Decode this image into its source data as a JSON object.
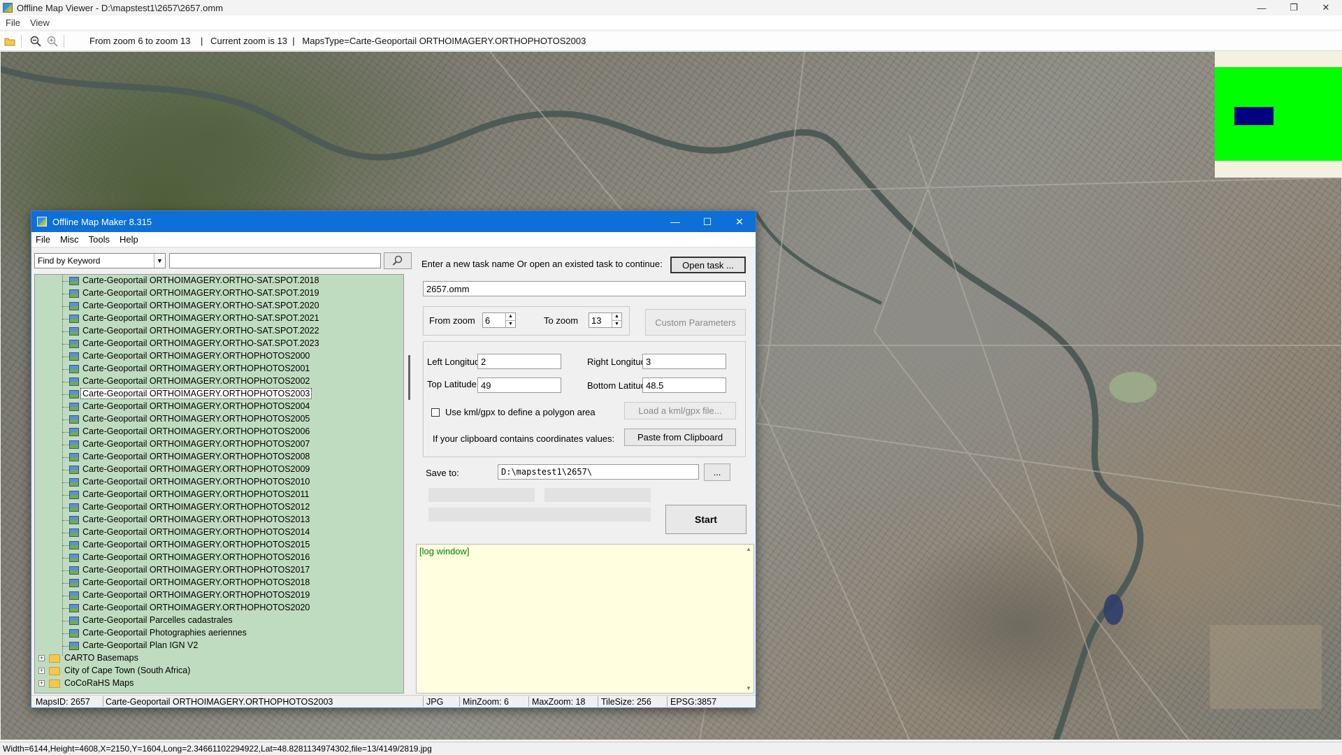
{
  "viewer": {
    "title": "Offline Map Viewer - D:\\mapstest1\\2657\\2657.omm",
    "menu": [
      "File",
      "View"
    ],
    "toolbar_info": "From zoom 6 to zoom 13    |   Current zoom is 13  |   MapsType=Carte-Geoportail ORTHOIMAGERY.ORTHOPHOTOS2003",
    "status": "Width=6144,Height=4608,X=2150,Y=1604,Long=2.34661102294922,Lat=48.8281134974302,file=13/4149/2819.jpg",
    "icons": [
      "open-folder-icon",
      "zoom-out-icon",
      "zoom-in-icon"
    ]
  },
  "dialog": {
    "title": "Offline Map Maker 8.315",
    "menu": [
      "File",
      "Misc",
      "Tools",
      "Help"
    ],
    "search": {
      "mode": "Find by Keyword",
      "value": ""
    },
    "tree_items": [
      "Carte-Geoportail ORTHOIMAGERY.ORTHO-SAT.SPOT.2018",
      "Carte-Geoportail ORTHOIMAGERY.ORTHO-SAT.SPOT.2019",
      "Carte-Geoportail ORTHOIMAGERY.ORTHO-SAT.SPOT.2020",
      "Carte-Geoportail ORTHOIMAGERY.ORTHO-SAT.SPOT.2021",
      "Carte-Geoportail ORTHOIMAGERY.ORTHO-SAT.SPOT.2022",
      "Carte-Geoportail ORTHOIMAGERY.ORTHO-SAT.SPOT.2023",
      "Carte-Geoportail ORTHOIMAGERY.ORTHOPHOTOS2000",
      "Carte-Geoportail ORTHOIMAGERY.ORTHOPHOTOS2001",
      "Carte-Geoportail ORTHOIMAGERY.ORTHOPHOTOS2002",
      "Carte-Geoportail ORTHOIMAGERY.ORTHOPHOTOS2003",
      "Carte-Geoportail ORTHOIMAGERY.ORTHOPHOTOS2004",
      "Carte-Geoportail ORTHOIMAGERY.ORTHOPHOTOS2005",
      "Carte-Geoportail ORTHOIMAGERY.ORTHOPHOTOS2006",
      "Carte-Geoportail ORTHOIMAGERY.ORTHOPHOTOS2007",
      "Carte-Geoportail ORTHOIMAGERY.ORTHOPHOTOS2008",
      "Carte-Geoportail ORTHOIMAGERY.ORTHOPHOTOS2009",
      "Carte-Geoportail ORTHOIMAGERY.ORTHOPHOTOS2010",
      "Carte-Geoportail ORTHOIMAGERY.ORTHOPHOTOS2011",
      "Carte-Geoportail ORTHOIMAGERY.ORTHOPHOTOS2012",
      "Carte-Geoportail ORTHOIMAGERY.ORTHOPHOTOS2013",
      "Carte-Geoportail ORTHOIMAGERY.ORTHOPHOTOS2014",
      "Carte-Geoportail ORTHOIMAGERY.ORTHOPHOTOS2015",
      "Carte-Geoportail ORTHOIMAGERY.ORTHOPHOTOS2016",
      "Carte-Geoportail ORTHOIMAGERY.ORTHOPHOTOS2017",
      "Carte-Geoportail ORTHOIMAGERY.ORTHOPHOTOS2018",
      "Carte-Geoportail ORTHOIMAGERY.ORTHOPHOTOS2019",
      "Carte-Geoportail ORTHOIMAGERY.ORTHOPHOTOS2020",
      "Carte-Geoportail Parcelles cadastrales",
      "Carte-Geoportail Photographies aeriennes",
      "Carte-Geoportail Plan IGN V2"
    ],
    "selected_item": "Carte-Geoportail ORTHOIMAGERY.ORTHOPHOTOS2003",
    "tree_folders": [
      "CARTO Basemaps",
      "City of Cape Town (South Africa)",
      "CoCoRaHS Maps"
    ],
    "task_prompt": "Enter a new task name Or open an existed task to continue:",
    "open_task_label": "Open task ...",
    "task_name": "2657.omm",
    "from_zoom_label": "From zoom",
    "from_zoom": "6",
    "to_zoom_label": "To zoom",
    "to_zoom": "13",
    "custom_params_label": "Custom Parameters",
    "left_lon_label": "Left Longitude",
    "left_lon": "2",
    "right_lon_label": "Right Longitude",
    "right_lon": "3",
    "top_lat_label": "Top Latitude",
    "top_lat": "49",
    "bottom_lat_label": "Bottom Latitude",
    "bottom_lat": "48.5",
    "kml_check_label": "Use kml/gpx to define a polygon area",
    "load_kml_label": "Load a kml/gpx file...",
    "clipboard_prompt": "If your clipboard contains coordinates values:",
    "paste_label": "Paste from Clipboard",
    "save_label": "Save to:",
    "save_path": "D:\\mapstest1\\2657\\",
    "browse_label": "...",
    "start_label": "Start",
    "log_text": "[log window]",
    "status": {
      "maps_id": "MapsID: 2657",
      "maps_name": "Carte-Geoportail ORTHOIMAGERY.ORTHOPHOTOS2003",
      "format": "JPG",
      "min_zoom": "MinZoom: 6",
      "max_zoom": "MaxZoom: 18",
      "tile_size": "TileSize: 256",
      "epsg": "EPSG:3857"
    }
  },
  "colors": {
    "tree_bg": "#c0dcc0",
    "log_bg": "#ffffe0",
    "overview_green": "#00ff00",
    "overview_rect": "#000080",
    "dialog_titlebar": "#0d6fd8"
  }
}
